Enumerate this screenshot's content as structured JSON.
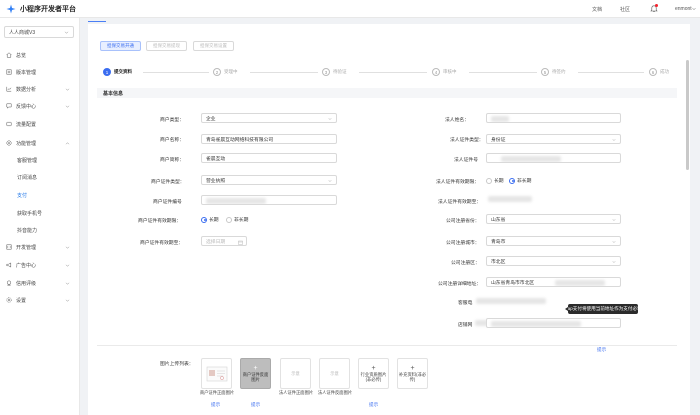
{
  "app": {
    "title": "小程序开发者平台"
  },
  "topnav": {
    "docs": "文档",
    "community": "社区",
    "user": "enmont"
  },
  "sidebar": {
    "shop": "人人商城V3",
    "items": [
      {
        "label": "总览",
        "icon": "home-icon"
      },
      {
        "label": "版本管理",
        "icon": "version-icon"
      },
      {
        "label": "数据分析",
        "icon": "chart-icon",
        "arrow": true
      },
      {
        "label": "反馈中心",
        "icon": "feedback-icon",
        "arrow": true
      },
      {
        "label": "流量配置",
        "icon": "traffic-icon"
      },
      {
        "label": "功能管理",
        "icon": "function-icon",
        "arrow": "up"
      }
    ],
    "sub_items": [
      "客服管理",
      "订阅消息",
      "支付",
      "获取手机号",
      "抖音能力"
    ],
    "bottom_items": [
      {
        "label": "开发管理",
        "icon": "code-icon",
        "arrow": true
      },
      {
        "label": "广告中心",
        "icon": "ad-icon",
        "arrow": true
      },
      {
        "label": "信用评级",
        "icon": "credit-icon",
        "arrow": true
      },
      {
        "label": "设置",
        "icon": "settings-icon",
        "arrow": true
      }
    ]
  },
  "toolbar": {
    "btn1": "担保交易开通",
    "btn2": "担保交易提现",
    "btn3": "担保交易设置"
  },
  "steps": [
    "提交资料",
    "受理中",
    "待验证",
    "审核中",
    "待签约",
    "成功"
  ],
  "section": {
    "title": "基本信息"
  },
  "form_left": {
    "merchant_type_label": "商户类型：",
    "merchant_type_value": "企业",
    "merchant_name_label": "商户名称：",
    "merchant_name_value": "青岛雀晨互动网络科技有限公司",
    "merchant_short_label": "商户简称：",
    "merchant_short_value": "雀晨互动",
    "cert_type_label": "商户证件类型：",
    "cert_type_value": "营业执照",
    "cert_no_label": "商户证件编号",
    "cert_valid_label": "商户证件有效期限：",
    "cert_valid_long": "长期",
    "cert_valid_short": "非长期",
    "cert_end_label": "商户证件有效期至：",
    "cert_end_placeholder": "选择日期"
  },
  "form_right": {
    "legal_name_label": "法人姓名：",
    "legal_cert_type_label": "法人证件类型：",
    "legal_cert_type_value": "身份证",
    "legal_cert_no_label": "法人证件号",
    "legal_valid_label": "法人证件有效期限：",
    "legal_valid_long": "长期",
    "legal_valid_short": "非长期",
    "legal_end_label": "法人证件有效期至：",
    "province_label": "公司注册省份：",
    "province_value": "山东省",
    "city_label": "公司注册城市：",
    "city_value": "青岛市",
    "district_label": "公司注册区：",
    "district_value": "市北区",
    "address_label": "公司注册详细地址：",
    "address_value": "山东省青岛市市北区",
    "phone_label": "客服电",
    "store_label": "店铺网",
    "tooltip": "wap支付将使用当前地址作为支付必填",
    "hint": "提示"
  },
  "uploads": {
    "label": "图片上传列表：",
    "items": [
      {
        "caption": "商户证件正面图片",
        "hint": "提示"
      },
      {
        "box_text": "商户证件反面图片",
        "caption": "",
        "hint": "提示"
      },
      {
        "box_text": "示意",
        "caption": "法人证件正面图片",
        "hint": ""
      },
      {
        "box_text": "示意",
        "caption": "法人证件反面图片",
        "hint": ""
      },
      {
        "box_text": "行业资质图片(非必传)",
        "caption": "",
        "hint": "提示"
      },
      {
        "box_text": "补充资料(非必传)",
        "caption": "",
        "hint": ""
      }
    ]
  },
  "colors": {
    "primary": "#3a6df0",
    "sidebar_active": "#1a73e8"
  }
}
